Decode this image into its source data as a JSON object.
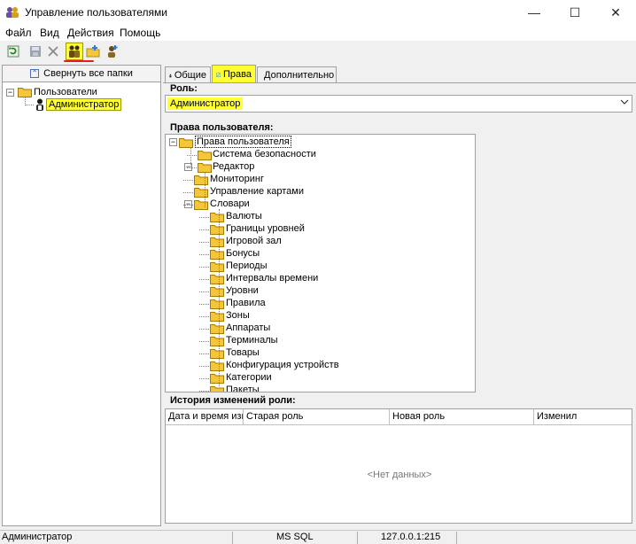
{
  "window": {
    "title": "Управление пользователями",
    "controls": {
      "minimize": "—",
      "maximize": "☐",
      "close": "✕"
    }
  },
  "menu": [
    {
      "label": "Файл"
    },
    {
      "label": "Вид"
    },
    {
      "label": "Действия"
    },
    {
      "label": "Помощь"
    }
  ],
  "toolbar": {
    "buttons": [
      {
        "icon": "refresh-icon"
      },
      {
        "icon": "save-icon"
      },
      {
        "icon": "delete-icon"
      },
      {
        "icon": "users-icon",
        "active": true
      },
      {
        "icon": "add-folder-icon"
      },
      {
        "icon": "add-user-icon"
      }
    ]
  },
  "left_panel": {
    "collapse_label": "Свернуть все папки",
    "tree": [
      {
        "label": "Пользователи",
        "type": "folder"
      },
      {
        "label": "Администратор",
        "type": "user",
        "selected": true
      }
    ]
  },
  "tabs": [
    {
      "label": "Общие"
    },
    {
      "label": "Права",
      "active": true
    },
    {
      "label": "Дополнительно"
    }
  ],
  "role": {
    "label": "Роль:",
    "value": "Администратор"
  },
  "rights": {
    "label": "Права пользователя:",
    "tree": [
      {
        "label": "Права пользователя",
        "level": 0
      },
      {
        "label": "Система безопасности",
        "level": 1
      },
      {
        "label": "Редактор",
        "level": 1
      },
      {
        "label": "Мониторинг",
        "level": 2
      },
      {
        "label": "Управление картами",
        "level": 2
      },
      {
        "label": "Словари",
        "level": 2
      },
      {
        "label": "Валюты",
        "level": 3
      },
      {
        "label": "Границы уровней",
        "level": 3
      },
      {
        "label": "Игровой зал",
        "level": 3
      },
      {
        "label": "Бонусы",
        "level": 3
      },
      {
        "label": "Периоды",
        "level": 3
      },
      {
        "label": "Интервалы времени",
        "level": 3
      },
      {
        "label": "Уровни",
        "level": 3
      },
      {
        "label": "Правила",
        "level": 3
      },
      {
        "label": "Зоны",
        "level": 3
      },
      {
        "label": "Аппараты",
        "level": 3
      },
      {
        "label": "Терминалы",
        "level": 3
      },
      {
        "label": "Товары",
        "level": 3
      },
      {
        "label": "Конфигурация устройств",
        "level": 3
      },
      {
        "label": "Категории",
        "level": 3
      },
      {
        "label": "Пакеты",
        "level": 3
      }
    ]
  },
  "history": {
    "label": "История изменений роли:",
    "columns": [
      "Дата и время изме",
      "Старая роль",
      "Новая роль",
      "Изменил"
    ],
    "empty_text": "<Нет данных>"
  },
  "status": {
    "user": "Администратор",
    "db": "MS SQL",
    "server": "127.0.0.1:215"
  },
  "colors": {
    "highlight": "#ffff33",
    "folder": "#f5c53a"
  }
}
